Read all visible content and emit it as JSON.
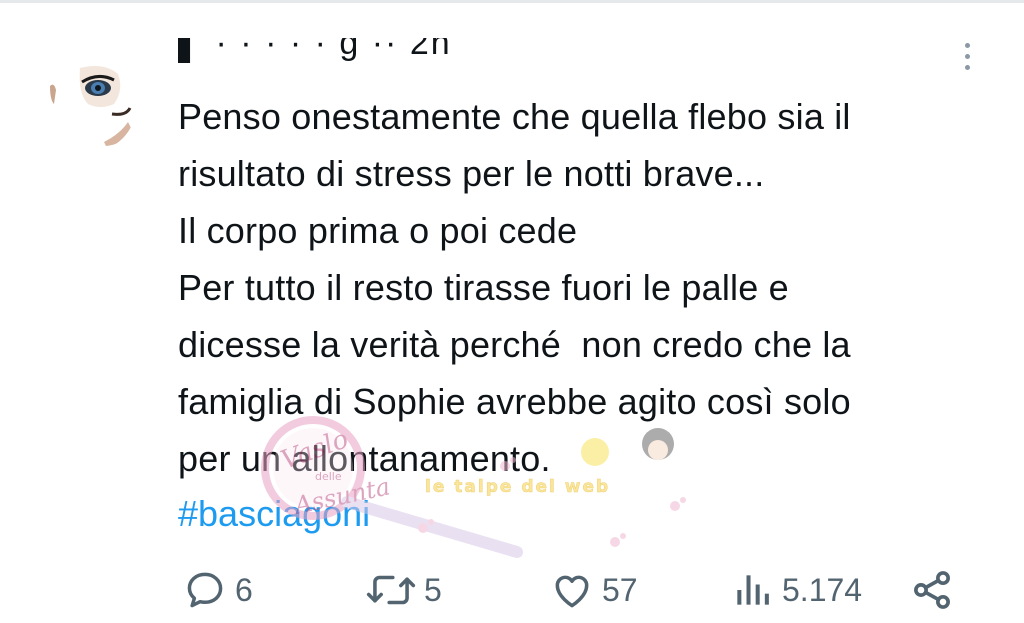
{
  "tweet": {
    "header_partial": "▌      ·          ·         ·  ·  · g  ··  2h",
    "text_lines": [
      "Penso onestamente che quella flebo sia il",
      "risultato di stress per le notti brave...",
      "Il corpo prima o poi cede",
      "Per tutto il resto tirasse fuori le palle e",
      "dicesse la verità perché  non credo che la",
      "famiglia di Sophie avrebbe agito così solo",
      "per un allontanamento."
    ],
    "hashtag": "#basciagoni"
  },
  "watermark": {
    "line1": "Vaslo",
    "line2": "delle",
    "line3": "Assunta",
    "banner": "le talpe del web"
  },
  "actions": {
    "reply_count": "6",
    "retweet_count": "5",
    "like_count": "57",
    "views_count": "5.174"
  },
  "icons": {
    "reply": "speech-bubble-icon",
    "retweet": "retweet-arrows-icon",
    "like": "heart-icon",
    "views": "bar-chart-icon",
    "share": "share-nodes-icon",
    "more": "vertical-dots-icon"
  },
  "colors": {
    "text": "#0f1419",
    "secondary": "#536471",
    "hashtag": "#1d9bf0"
  }
}
